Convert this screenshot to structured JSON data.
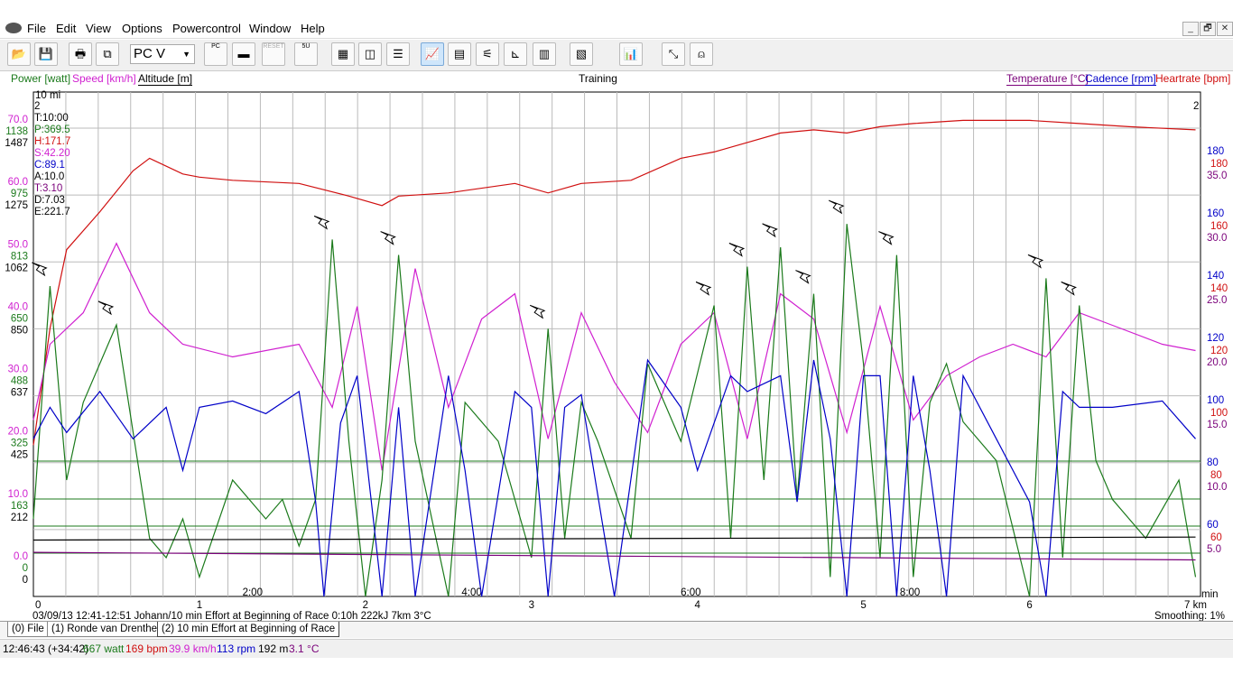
{
  "menu": [
    "File",
    "Edit",
    "View",
    "Options",
    "Powercontrol",
    "Window",
    "Help"
  ],
  "window_controls": [
    "_",
    "🗗",
    "✕"
  ],
  "toolbar": {
    "pc_select": "PC V",
    "reset_label": "RESET",
    "pc_label": "PC",
    "pc5u_label": "5U"
  },
  "legend": {
    "power": "Power [watt]",
    "speed": "Speed [km/h]",
    "altitude": "Altitude [m]",
    "title": "Training",
    "temperature": "Temperature [°C]",
    "cadence": "Cadence [rpm]",
    "heartrate": "Heartrate [bpm]"
  },
  "colors": {
    "power": "#1b7a1b",
    "speed": "#d020d0",
    "altitude": "#000000",
    "temperature": "#7a007a",
    "cadence": "#0000c8",
    "heartrate": "#d01010"
  },
  "readout": {
    "scale_label": "10 mi",
    "lap": "2",
    "lap_right": "2",
    "lines": [
      {
        "text": "T:10:00",
        "color": "#000000"
      },
      {
        "text": "P:369.5",
        "color": "#1b7a1b"
      },
      {
        "text": "H:171.7",
        "color": "#d01010"
      },
      {
        "text": "S:42.20",
        "color": "#d020d0"
      },
      {
        "text": "C:89.1",
        "color": "#0000c8"
      },
      {
        "text": "A:10.0",
        "color": "#000000"
      },
      {
        "text": "T:3.10",
        "color": "#7a007a"
      },
      {
        "text": "D:7.03",
        "color": "#000000"
      },
      {
        "text": "E:221.7",
        "color": "#000000"
      }
    ]
  },
  "chart_data": [
    {
      "type": "line",
      "title": "Training",
      "xlabel": "min",
      "x_time_ticks": [
        "2:00",
        "4:00",
        "6:00",
        "8:00"
      ],
      "x_distance_ticks": [
        "1",
        "2",
        "3",
        "4",
        "5",
        "6",
        "7 km"
      ],
      "left_axes": {
        "speed": [
          "70.0",
          "60.0",
          "50.0",
          "40.0",
          "30.0",
          "20.0",
          "10.0",
          "0.0"
        ],
        "power": [
          "1138",
          "975",
          "813",
          "650",
          "488",
          "325",
          "163",
          "0"
        ],
        "altitude": [
          "1487",
          "1275",
          "1062",
          "850",
          "637",
          "425",
          "212",
          "0"
        ]
      },
      "right_axes": {
        "cadence": [
          "180",
          "160",
          "140",
          "120",
          "100",
          "80",
          "60"
        ],
        "heartrate": [
          "180",
          "160",
          "140",
          "120",
          "100",
          "80",
          "60"
        ],
        "temperature": [
          "35.0",
          "30.0",
          "25.0",
          "20.0",
          "15.0",
          "10.0",
          "5.0"
        ]
      },
      "x_range_km": [
        0,
        7.03
      ],
      "series": [
        {
          "name": "Heartrate [bpm]",
          "x": [
            0,
            0.1,
            0.2,
            0.4,
            0.6,
            0.7,
            0.9,
            1.0,
            1.2,
            1.6,
            1.9,
            2.1,
            2.2,
            2.5,
            2.9,
            3.1,
            3.3,
            3.6,
            3.9,
            4.1,
            4.3,
            4.5,
            4.7,
            4.9,
            5.1,
            5.3,
            5.6,
            6.0,
            6.3,
            6.6,
            7.0
          ],
          "values": [
            88,
            125,
            150,
            162,
            175,
            179,
            174,
            173,
            172,
            171,
            167,
            164,
            167,
            168,
            171,
            168,
            171,
            172,
            179,
            181,
            184,
            187,
            188,
            187,
            189,
            190,
            191,
            191,
            190,
            189,
            188
          ]
        },
        {
          "name": "Speed [km/h]",
          "x": [
            0,
            0.1,
            0.3,
            0.5,
            0.7,
            0.9,
            1.2,
            1.6,
            1.8,
            1.95,
            2.1,
            2.3,
            2.5,
            2.7,
            2.9,
            3.1,
            3.3,
            3.5,
            3.7,
            3.9,
            4.1,
            4.3,
            4.5,
            4.7,
            4.9,
            5.1,
            5.3,
            5.5,
            5.7,
            5.9,
            6.1,
            6.3,
            6.5,
            6.8,
            7.0
          ],
          "values": [
            28,
            40,
            45,
            56,
            45,
            40,
            38,
            40,
            30,
            46,
            20,
            52,
            30,
            44,
            48,
            25,
            45,
            34,
            26,
            40,
            45,
            25,
            48,
            44,
            26,
            46,
            28,
            35,
            38,
            40,
            38,
            45,
            43,
            40,
            39
          ]
        },
        {
          "name": "Power [watt]",
          "x": [
            0,
            0.1,
            0.2,
            0.3,
            0.5,
            0.7,
            0.8,
            0.9,
            1.0,
            1.2,
            1.4,
            1.5,
            1.6,
            1.7,
            1.8,
            1.9,
            2.0,
            2.1,
            2.2,
            2.3,
            2.5,
            2.6,
            2.8,
            2.9,
            3.0,
            3.1,
            3.2,
            3.3,
            3.4,
            3.6,
            3.7,
            3.9,
            4.1,
            4.2,
            4.3,
            4.4,
            4.5,
            4.6,
            4.7,
            4.8,
            4.9,
            5.0,
            5.1,
            5.2,
            5.3,
            5.4,
            5.5,
            5.6,
            5.8,
            6.0,
            6.1,
            6.2,
            6.3,
            6.4,
            6.5,
            6.7,
            6.9,
            7.0
          ],
          "values": [
            200,
            800,
            300,
            500,
            700,
            150,
            100,
            200,
            50,
            300,
            200,
            250,
            130,
            250,
            920,
            400,
            0,
            300,
            880,
            400,
            0,
            500,
            400,
            250,
            100,
            690,
            150,
            500,
            400,
            150,
            600,
            400,
            750,
            150,
            850,
            300,
            900,
            250,
            780,
            50,
            960,
            600,
            100,
            880,
            50,
            500,
            600,
            450,
            350,
            0,
            820,
            100,
            750,
            350,
            250,
            150,
            300,
            50
          ]
        },
        {
          "name": "Cadence [rpm]",
          "x": [
            0,
            0.1,
            0.2,
            0.4,
            0.6,
            0.8,
            0.9,
            1.0,
            1.2,
            1.4,
            1.6,
            1.7,
            1.75,
            1.85,
            1.95,
            2.1,
            2.2,
            2.3,
            2.5,
            2.6,
            2.7,
            2.9,
            3.0,
            3.1,
            3.2,
            3.3,
            3.5,
            3.7,
            3.9,
            4.0,
            4.2,
            4.3,
            4.5,
            4.6,
            4.7,
            4.8,
            4.9,
            5.0,
            5.1,
            5.2,
            5.3,
            5.4,
            5.5,
            5.6,
            5.8,
            6.0,
            6.1,
            6.2,
            6.3,
            6.5,
            6.8,
            7.0
          ],
          "values": [
            90,
            100,
            92,
            105,
            90,
            100,
            80,
            100,
            102,
            98,
            105,
            70,
            20,
            95,
            110,
            30,
            100,
            10,
            110,
            80,
            40,
            105,
            100,
            20,
            100,
            104,
            40,
            115,
            100,
            80,
            110,
            105,
            110,
            70,
            115,
            90,
            20,
            110,
            110,
            20,
            110,
            80,
            40,
            110,
            90,
            70,
            20,
            105,
            100,
            100,
            102,
            90
          ]
        },
        {
          "name": "Altitude [m]",
          "x": [
            0,
            7.0
          ],
          "values": [
            190,
            200
          ]
        },
        {
          "name": "Temperature [°C]",
          "x": [
            0,
            3.5,
            7.0
          ],
          "values": [
            3.5,
            3.2,
            2.9
          ]
        }
      ],
      "marker_note": "lightning markers at power peaks"
    }
  ],
  "chart_info": "03/09/13 12:41-12:51 Johann/10 min Effort at Beginning of Race 0:10h 222kJ 7km 3°C",
  "smoothing": "Smoothing: 1%",
  "tabs": [
    "(0) File",
    "(1) Ronde van Drenthe",
    "(2) 10 min Effort at Beginning of Race"
  ],
  "status": {
    "time": "12:46:43 (+34:42)",
    "power": "667 watt",
    "hr": "169 bpm",
    "speed": "39.9 km/h",
    "cadence": "113 rpm",
    "altitude": "192 m",
    "temp": "3.1 °C"
  }
}
